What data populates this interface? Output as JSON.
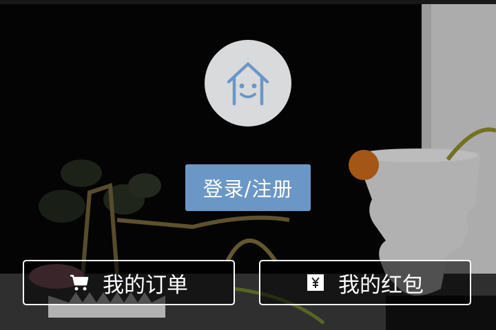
{
  "login": {
    "label": "登录/注册"
  },
  "actions": {
    "orders": {
      "label": "我的订单",
      "icon": "cart-icon"
    },
    "redpacket": {
      "label": "我的红包",
      "icon": "yen-icon"
    }
  },
  "avatar": {
    "icon": "house-smile-icon"
  },
  "colors": {
    "login_button": "#6b97c6",
    "avatar_bg": "#d9dadc",
    "avatar_icon": "#6b97c6",
    "action_border": "#ffffff"
  }
}
